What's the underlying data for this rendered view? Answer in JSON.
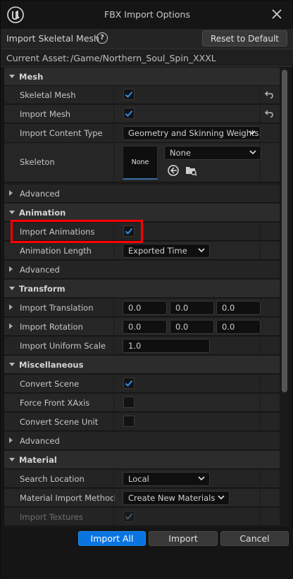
{
  "window": {
    "title": "FBX Import Options",
    "close_icon": "close-icon",
    "logo": "unreal-logo"
  },
  "header": {
    "label": "Import Skeletal Mesh",
    "help_icon": "?",
    "reset_label": "Reset to Default"
  },
  "asset": {
    "label": "Current Asset:",
    "path": "/Game/Northern_Soul_Spin_XXXL"
  },
  "sections": {
    "mesh": {
      "title": "Mesh",
      "skeletal_mesh": {
        "label": "Skeletal Mesh",
        "checked": true
      },
      "import_mesh": {
        "label": "Import Mesh",
        "checked": true
      },
      "content_type": {
        "label": "Import Content Type",
        "value": "Geometry and Skinning Weights."
      },
      "skeleton": {
        "label": "Skeleton",
        "thumb_text": "None",
        "value": "None"
      },
      "advanced": "Advanced"
    },
    "animation": {
      "title": "Animation",
      "import_animations": {
        "label": "Import Animations",
        "checked": true
      },
      "length": {
        "label": "Animation Length",
        "value": "Exported Time"
      },
      "advanced": "Advanced"
    },
    "transform": {
      "title": "Transform",
      "translation": {
        "label": "Import Translation",
        "x": "0.0",
        "y": "0.0",
        "z": "0.0"
      },
      "rotation": {
        "label": "Import Rotation",
        "x": "0.0",
        "y": "0.0",
        "z": "0.0"
      },
      "scale": {
        "label": "Import Uniform Scale",
        "value": "1.0"
      }
    },
    "misc": {
      "title": "Miscellaneous",
      "convert_scene": {
        "label": "Convert Scene",
        "checked": true
      },
      "force_front_x": {
        "label": "Force Front XAxis",
        "checked": false
      },
      "convert_unit": {
        "label": "Convert Scene Unit",
        "checked": false
      },
      "advanced": "Advanced"
    },
    "material": {
      "title": "Material",
      "search_location": {
        "label": "Search Location",
        "value": "Local"
      },
      "import_method": {
        "label": "Material Import Method",
        "value": "Create New Materials"
      },
      "import_textures": {
        "label": "Import Textures",
        "checked": true,
        "disabled": true
      }
    }
  },
  "footer": {
    "import_all": "Import All",
    "import": "Import",
    "cancel": "Cancel"
  },
  "colors": {
    "accent": "#0a74e0",
    "highlight": "#ff0000",
    "check": "#2f8cf0"
  }
}
